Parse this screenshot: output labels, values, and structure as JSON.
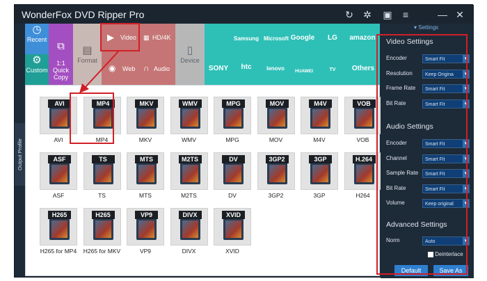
{
  "window": {
    "title": "WonderFox DVD Ripper Pro",
    "controls": {
      "refresh": "↻",
      "settings": "✲",
      "chat": "▣",
      "menu": "≡",
      "minimize": "—",
      "close": "✕"
    }
  },
  "toolbar": {
    "recent": "Recent",
    "custom": "Custom",
    "quick": "1:1\nQuick\nCopy",
    "format": "Format",
    "video": "Video",
    "hd": "HD/4K",
    "web": "Web",
    "audio": "Audio",
    "device": "Device",
    "brands": [
      "Samsung",
      "Microsoft",
      "Google",
      "LG",
      "amazon",
      "SONY",
      "htc",
      "lenovo",
      "HUAWEI",
      "TV",
      "Others"
    ]
  },
  "side_tab": "Output Profile",
  "formats": [
    {
      "tag": "AVI",
      "label": "AVI"
    },
    {
      "tag": "MP4",
      "label": "MP4",
      "selected": true
    },
    {
      "tag": "MKV",
      "label": "MKV"
    },
    {
      "tag": "WMV",
      "label": "WMV"
    },
    {
      "tag": "MPG",
      "label": "MPG"
    },
    {
      "tag": "MOV",
      "label": "MOV"
    },
    {
      "tag": "M4V",
      "label": "M4V"
    },
    {
      "tag": "VOB",
      "label": "VOB"
    },
    {
      "tag": "ASF",
      "label": "ASF"
    },
    {
      "tag": "TS",
      "label": "TS"
    },
    {
      "tag": "MTS",
      "label": "MTS"
    },
    {
      "tag": "M2TS",
      "label": "M2TS"
    },
    {
      "tag": "DV",
      "label": "DV"
    },
    {
      "tag": "3GP2",
      "label": "3GP2"
    },
    {
      "tag": "3GP",
      "label": "3GP"
    },
    {
      "tag": "H.264",
      "label": "H264"
    },
    {
      "tag": "H265",
      "label": "H265 for MP4"
    },
    {
      "tag": "H265",
      "label": "H265 for MKV"
    },
    {
      "tag": "VP9",
      "label": "VP9"
    },
    {
      "tag": "DIVX",
      "label": "DIVX"
    },
    {
      "tag": "XVID",
      "label": "XVID"
    }
  ],
  "panel": {
    "settings_link": "Settings",
    "video_title": "Video Settings",
    "video_rows": [
      {
        "label": "Encoder",
        "value": "Smart Fit"
      },
      {
        "label": "Resolution",
        "value": "Keep Origina"
      },
      {
        "label": "Frame Rate",
        "value": "Smart Fit"
      },
      {
        "label": "Bit Rate",
        "value": "Smart Fit"
      }
    ],
    "audio_title": "Audio Settings",
    "audio_rows": [
      {
        "label": "Encoder",
        "value": "Smart Fit"
      },
      {
        "label": "Channel",
        "value": "Smart Fit"
      },
      {
        "label": "Sample Rate",
        "value": "Smart Fit"
      },
      {
        "label": "Bit Rate",
        "value": "Smart Fit"
      },
      {
        "label": "Volume",
        "value": "Keep original"
      }
    ],
    "advanced_title": "Advanced Settings",
    "norm_label": "Norm",
    "norm_value": "Auto",
    "deinterlace": "Deinterlace",
    "default_btn": "Default",
    "saveas_btn": "Save As"
  }
}
